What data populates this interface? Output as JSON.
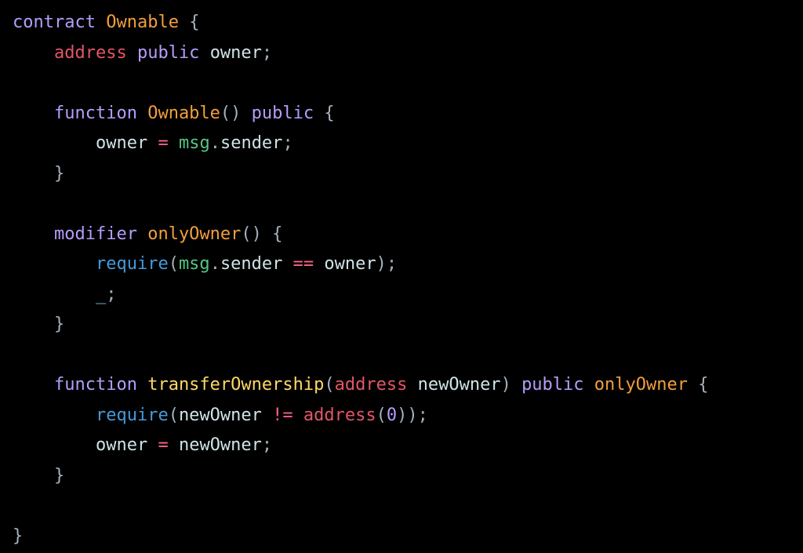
{
  "code": {
    "line1": {
      "t1": "contract",
      "t2": " ",
      "t3": "Ownable",
      "t4": " ",
      "t5": "{"
    },
    "line2": {
      "indent": "    ",
      "t1": "address",
      "t2": " ",
      "t3": "public",
      "t4": " ",
      "t5": "owner",
      "t6": ";"
    },
    "line3": {
      "indent": "    ",
      "t1": "function",
      "t2": " ",
      "t3": "Ownable",
      "t4": "(",
      "t5": ")",
      "t6": " ",
      "t7": "public",
      "t8": " ",
      "t9": "{"
    },
    "line4": {
      "indent": "        ",
      "t1": "owner",
      "t2": " ",
      "t3": "=",
      "t4": " ",
      "t5": "msg",
      "t6": ".",
      "t7": "sender",
      "t8": ";"
    },
    "line5": {
      "indent": "    ",
      "t1": "}"
    },
    "line6": {
      "indent": "    ",
      "t1": "modifier",
      "t2": " ",
      "t3": "onlyOwner",
      "t4": "(",
      "t5": ")",
      "t6": " ",
      "t7": "{"
    },
    "line7": {
      "indent": "        ",
      "t1": "require",
      "t2": "(",
      "t3": "msg",
      "t4": ".",
      "t5": "sender",
      "t6": " ",
      "t7": "==",
      "t8": " ",
      "t9": "owner",
      "t10": ")",
      "t11": ";"
    },
    "line8": {
      "indent": "        ",
      "t1": "_",
      "t2": ";"
    },
    "line9": {
      "indent": "    ",
      "t1": "}"
    },
    "line10": {
      "indent": "    ",
      "t1": "function",
      "t2": " ",
      "t3": "transferOwnership",
      "t4": "(",
      "t5": "address",
      "t6": " ",
      "t7": "newOwner",
      "t8": ")",
      "t9": " ",
      "t10": "public",
      "t11": " ",
      "t12": "onlyOwner",
      "t13": " ",
      "t14": "{"
    },
    "line11": {
      "indent": "        ",
      "t1": "require",
      "t2": "(",
      "t3": "newOwner",
      "t4": " ",
      "t5": "!=",
      "t6": " ",
      "t7": "address",
      "t8": "(",
      "t9": "0",
      "t10": ")",
      "t11": ")",
      "t12": ";"
    },
    "line12": {
      "indent": "        ",
      "t1": "owner",
      "t2": " ",
      "t3": "=",
      "t4": " ",
      "t5": "newOwner",
      "t6": ";"
    },
    "line13": {
      "indent": "    ",
      "t1": "}"
    },
    "line14": {
      "t1": "}"
    }
  }
}
